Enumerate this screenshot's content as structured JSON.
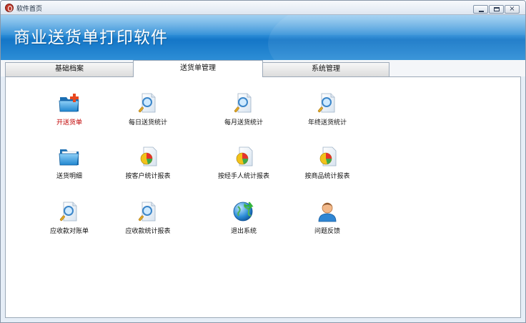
{
  "window": {
    "title": "软件首页",
    "app_title": "商业送货单打印软件",
    "controls": {
      "minimize": "minimize",
      "maximize": "maximize",
      "close": "×"
    }
  },
  "tabs": [
    {
      "label": "基础档案",
      "active": false
    },
    {
      "label": "送货单管理",
      "active": true
    },
    {
      "label": "系统管理",
      "active": false
    }
  ],
  "items": [
    {
      "label": "开送货单",
      "icon": "folder-add-icon",
      "highlight": true
    },
    {
      "label": "每日送货统计",
      "icon": "report-search-icon",
      "highlight": false
    },
    {
      "label": "每月送货统计",
      "icon": "report-search-icon",
      "highlight": false
    },
    {
      "label": "年终送货统计",
      "icon": "report-search-icon",
      "highlight": false
    },
    {
      "label": "送货明细",
      "icon": "folder-icon",
      "highlight": false
    },
    {
      "label": "按客户统计报表",
      "icon": "pie-chart-report-icon",
      "highlight": false
    },
    {
      "label": "按经手人统计报表",
      "icon": "pie-chart-report-icon",
      "highlight": false
    },
    {
      "label": "按商品统计报表",
      "icon": "pie-chart-report-icon",
      "highlight": false
    },
    {
      "label": "应收款对账单",
      "icon": "report-search-icon",
      "highlight": false
    },
    {
      "label": "应收款统计报表",
      "icon": "report-search-icon",
      "highlight": false
    },
    {
      "label": "退出系统",
      "icon": "globe-exit-icon",
      "highlight": false
    },
    {
      "label": "问题反馈",
      "icon": "user-feedback-icon",
      "highlight": false
    }
  ],
  "colors": {
    "banner": "#1f82d0",
    "highlight_label": "#c00000"
  }
}
